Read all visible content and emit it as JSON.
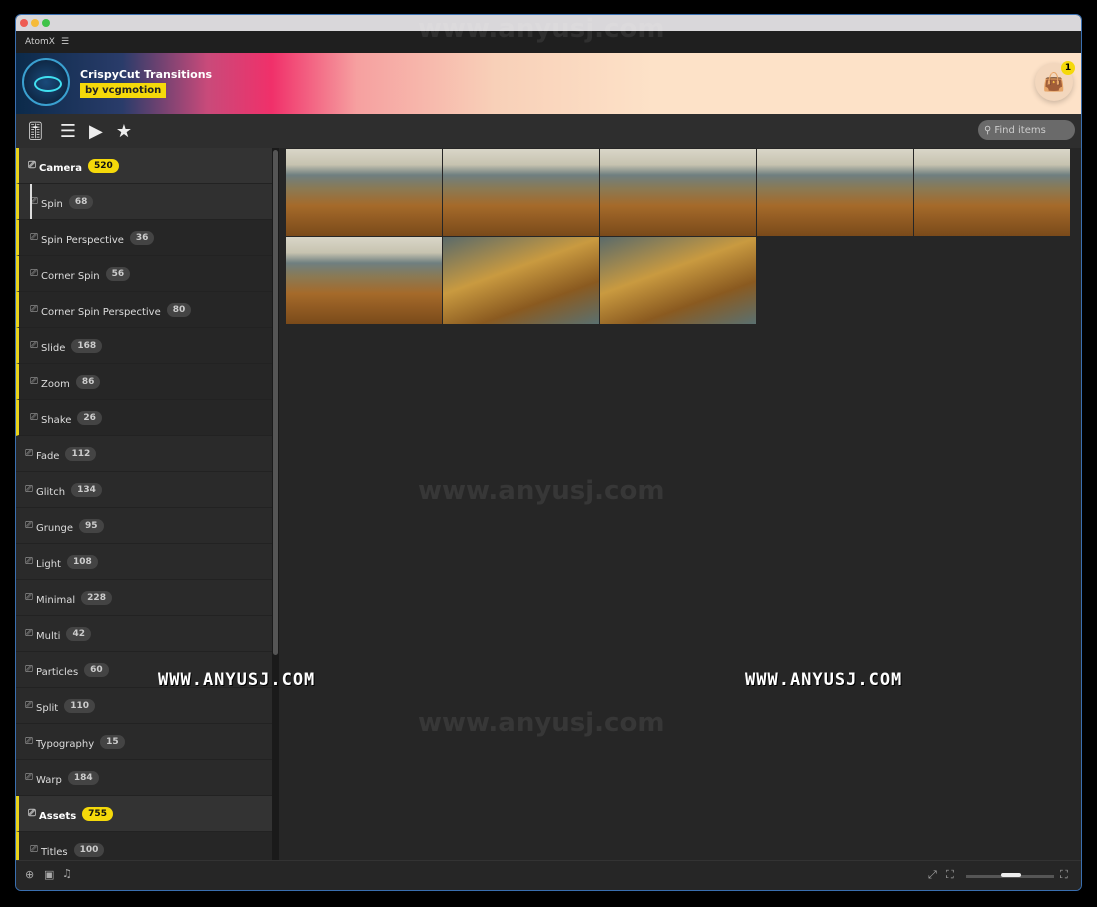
{
  "app": {
    "title": "AtomX",
    "menu_icon": "hamburger-icon"
  },
  "banner": {
    "title": "CrispyCut Transitions",
    "byline": "by vcgmotion",
    "cart_count": "1"
  },
  "toolbar": {
    "search_placeholder": "Find items"
  },
  "sidebar": {
    "categories": [
      {
        "label": "Camera",
        "count": "520",
        "open": true,
        "children": [
          {
            "label": "Spin",
            "count": "68",
            "active": true
          },
          {
            "label": "Spin Perspective",
            "count": "36"
          },
          {
            "label": "Corner Spin",
            "count": "56"
          },
          {
            "label": "Corner Spin Perspective",
            "count": "80"
          },
          {
            "label": "Slide",
            "count": "168"
          },
          {
            "label": "Zoom",
            "count": "86"
          },
          {
            "label": "Shake",
            "count": "26"
          }
        ]
      },
      {
        "label": "Fade",
        "count": "112"
      },
      {
        "label": "Glitch",
        "count": "134"
      },
      {
        "label": "Grunge",
        "count": "95"
      },
      {
        "label": "Light",
        "count": "108"
      },
      {
        "label": "Minimal",
        "count": "228"
      },
      {
        "label": "Multi",
        "count": "42"
      },
      {
        "label": "Particles",
        "count": "60"
      },
      {
        "label": "Split",
        "count": "110"
      },
      {
        "label": "Typography",
        "count": "15"
      },
      {
        "label": "Warp",
        "count": "184"
      },
      {
        "label": "Assets",
        "count": "755",
        "open": true,
        "children": [
          {
            "label": "Titles",
            "count": "100"
          }
        ]
      }
    ]
  },
  "thumbnails": 8,
  "watermarks": [
    "WWW.ANYUSJ.COM",
    "WWW.ANYUSJ.COM",
    "www.anyusj.com"
  ],
  "colors": {
    "accent": "#f5d90a",
    "bg": "#262626"
  }
}
